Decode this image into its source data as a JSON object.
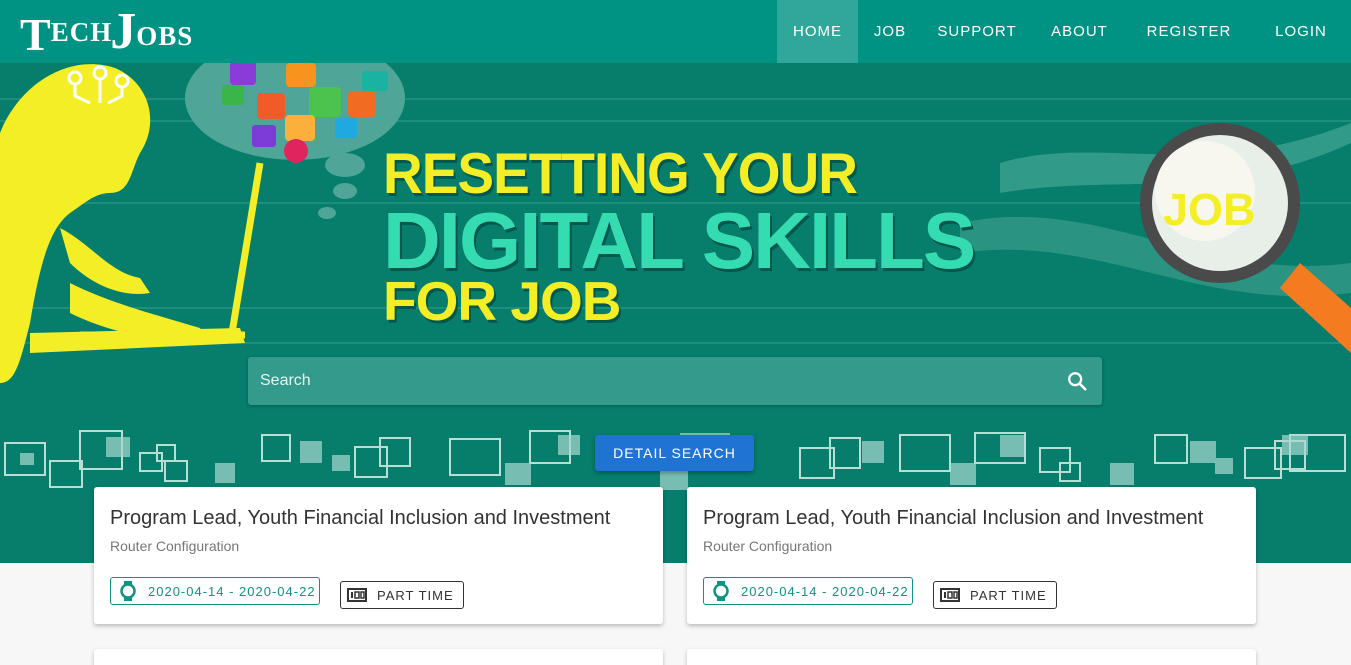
{
  "brand": {
    "logo_t": "T",
    "logo_ech": "ECH",
    "logo_j": "J",
    "logo_obs": "OBS"
  },
  "nav": {
    "items": [
      {
        "label": "HOME",
        "active": true
      },
      {
        "label": "JOB"
      },
      {
        "label": "SUPPORT"
      },
      {
        "label": "ABOUT"
      },
      {
        "label": "REGISTER"
      },
      {
        "label": "LOGIN"
      }
    ]
  },
  "hero": {
    "line1": "RESETTING YOUR",
    "line2": "DIGITAL SKILLS",
    "line3": "FOR JOB",
    "magnifier_text": "JOB"
  },
  "search": {
    "placeholder": "Search",
    "icon": "search-icon"
  },
  "detail_search_label": "DETAIL SEARCH",
  "jobs": [
    {
      "title": "Program Lead, Youth Financial Inclusion and Investment",
      "subtitle": "Router Configuration",
      "dates": "2020-04-14 - 2020-04-22",
      "type": "PART TIME"
    },
    {
      "title": "Program Lead, Youth Financial Inclusion and Investment",
      "subtitle": "Router Configuration",
      "dates": "2020-04-14 - 2020-04-22",
      "type": "PART TIME"
    }
  ],
  "colors": {
    "nav": "#009384",
    "nav_active": "#31a79b",
    "hero_bg": "#077d6c",
    "yellow": "#f4ee26",
    "mint": "#35dcb1",
    "button": "#1f74d3",
    "badge": "#0e9384"
  }
}
